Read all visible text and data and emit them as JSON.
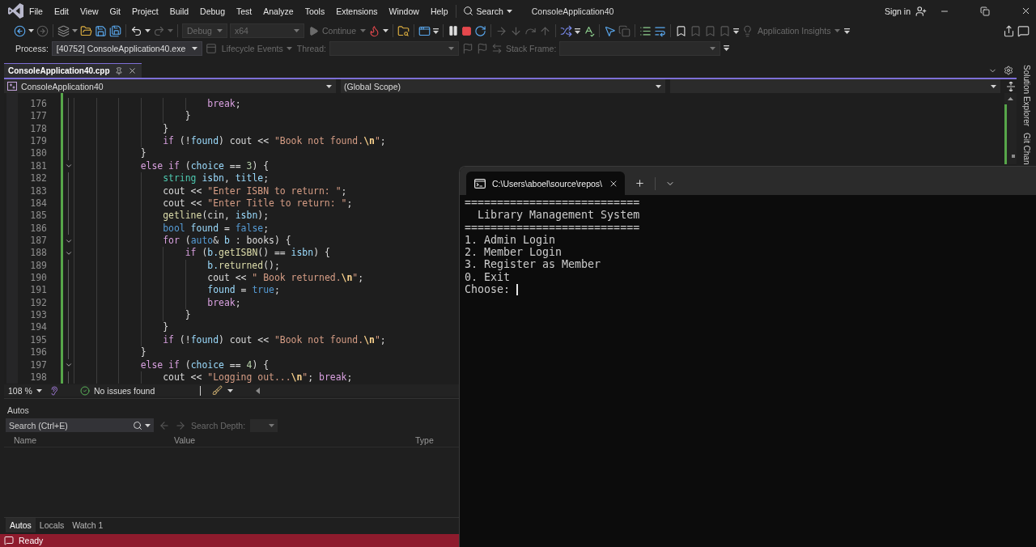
{
  "menu_bar": {
    "items": [
      "File",
      "Edit",
      "View",
      "Git",
      "Project",
      "Build",
      "Debug",
      "Test",
      "Analyze",
      "Tools",
      "Extensions",
      "Window",
      "Help"
    ],
    "search": "Search",
    "title": "ConsoleApplication40",
    "sign_in": "Sign in"
  },
  "toolbar": {
    "configuration": {
      "value": "Debug",
      "disabled": true
    },
    "platform": {
      "value": "x64",
      "disabled": true
    },
    "continue": {
      "label": "Continue",
      "disabled": true
    },
    "insights": {
      "label": "Application Insights",
      "disabled": true
    }
  },
  "debug_location": {
    "process": {
      "label": "Process:",
      "value": "[40752] ConsoleApplication40.exe"
    },
    "lifecycle": {
      "label": "Lifecycle Events",
      "disabled": true
    },
    "thread": {
      "label": "Thread:",
      "disabled": true
    },
    "stack_frame": {
      "label": "Stack Frame:",
      "disabled": true
    }
  },
  "document_tabs": [
    {
      "label": "ConsoleApplication40.cpp",
      "selected": true
    }
  ],
  "navigation": {
    "project": "ConsoleApplication40",
    "scope": "(Global Scope)"
  },
  "code": {
    "lines": [
      {
        "number": "176",
        "foldable": false,
        "tokens": [
          {
            "kind": "keyword",
            "text": "                        break"
          },
          {
            "kind": "plain",
            "text": ";"
          }
        ]
      },
      {
        "number": "177",
        "foldable": false,
        "tokens": [
          {
            "kind": "plain",
            "text": "                    }"
          }
        ]
      },
      {
        "number": "178",
        "foldable": false,
        "tokens": [
          {
            "kind": "plain",
            "text": "                }"
          }
        ]
      },
      {
        "number": "179",
        "foldable": false,
        "tokens": [
          {
            "kind": "keyword",
            "text": "                if"
          },
          {
            "kind": "plain",
            "text": " (!"
          },
          {
            "kind": "variable",
            "text": "found"
          },
          {
            "kind": "plain",
            "text": ") cout << "
          },
          {
            "kind": "string",
            "text": "\"Book not found."
          },
          {
            "kind": "escape",
            "text": "\\n"
          },
          {
            "kind": "string",
            "text": "\""
          },
          {
            "kind": "plain",
            "text": ";"
          }
        ]
      },
      {
        "number": "180",
        "foldable": false,
        "tokens": [
          {
            "kind": "plain",
            "text": "            }"
          }
        ]
      },
      {
        "number": "181",
        "foldable": true,
        "tokens": [
          {
            "kind": "keyword",
            "text": "            else if"
          },
          {
            "kind": "plain",
            "text": " ("
          },
          {
            "kind": "variable",
            "text": "choice"
          },
          {
            "kind": "plain",
            "text": " == "
          },
          {
            "kind": "number",
            "text": "3"
          },
          {
            "kind": "plain",
            "text": ") {"
          }
        ]
      },
      {
        "number": "182",
        "foldable": false,
        "tokens": [
          {
            "kind": "class",
            "text": "                string "
          },
          {
            "kind": "variable",
            "text": "isbn"
          },
          {
            "kind": "plain",
            "text": ", "
          },
          {
            "kind": "variable",
            "text": "title"
          },
          {
            "kind": "plain",
            "text": ";"
          }
        ]
      },
      {
        "number": "183",
        "foldable": false,
        "tokens": [
          {
            "kind": "plain",
            "text": "                cout << "
          },
          {
            "kind": "string",
            "text": "\"Enter ISBN to return: \""
          },
          {
            "kind": "plain",
            "text": ";"
          }
        ]
      },
      {
        "number": "184",
        "foldable": false,
        "tokens": [
          {
            "kind": "plain",
            "text": "                cout << "
          },
          {
            "kind": "string",
            "text": "\"Enter Title to return: \""
          },
          {
            "kind": "plain",
            "text": ";"
          }
        ]
      },
      {
        "number": "185",
        "foldable": false,
        "tokens": [
          {
            "kind": "function",
            "text": "                getline"
          },
          {
            "kind": "plain",
            "text": "(cin, "
          },
          {
            "kind": "variable",
            "text": "isbn"
          },
          {
            "kind": "plain",
            "text": ");"
          }
        ]
      },
      {
        "number": "186",
        "foldable": false,
        "tokens": [
          {
            "kind": "type",
            "text": "                bool "
          },
          {
            "kind": "variable",
            "text": "found"
          },
          {
            "kind": "plain",
            "text": " = "
          },
          {
            "kind": "type",
            "text": "false"
          },
          {
            "kind": "plain",
            "text": ";"
          }
        ]
      },
      {
        "number": "187",
        "foldable": true,
        "tokens": [
          {
            "kind": "keyword",
            "text": "                for"
          },
          {
            "kind": "plain",
            "text": " ("
          },
          {
            "kind": "type",
            "text": "auto"
          },
          {
            "kind": "plain",
            "text": "& "
          },
          {
            "kind": "variable",
            "text": "b"
          },
          {
            "kind": "plain",
            "text": " : books) {"
          }
        ]
      },
      {
        "number": "188",
        "foldable": true,
        "tokens": [
          {
            "kind": "keyword",
            "text": "                    if"
          },
          {
            "kind": "plain",
            "text": " ("
          },
          {
            "kind": "variable",
            "text": "b."
          },
          {
            "kind": "function",
            "text": "getISBN"
          },
          {
            "kind": "plain",
            "text": "() == "
          },
          {
            "kind": "variable",
            "text": "isbn"
          },
          {
            "kind": "plain",
            "text": ") {"
          }
        ]
      },
      {
        "number": "189",
        "foldable": false,
        "tokens": [
          {
            "kind": "variable",
            "text": "                        b."
          },
          {
            "kind": "function",
            "text": "returned"
          },
          {
            "kind": "plain",
            "text": "();"
          }
        ]
      },
      {
        "number": "190",
        "foldable": false,
        "tokens": [
          {
            "kind": "plain",
            "text": "                        cout << "
          },
          {
            "kind": "string",
            "text": "\" Book returned."
          },
          {
            "kind": "escape",
            "text": "\\n"
          },
          {
            "kind": "string",
            "text": "\""
          },
          {
            "kind": "plain",
            "text": ";"
          }
        ]
      },
      {
        "number": "191",
        "foldable": false,
        "tokens": [
          {
            "kind": "variable",
            "text": "                        found"
          },
          {
            "kind": "plain",
            "text": " = "
          },
          {
            "kind": "type",
            "text": "true"
          },
          {
            "kind": "plain",
            "text": ";"
          }
        ]
      },
      {
        "number": "192",
        "foldable": false,
        "tokens": [
          {
            "kind": "keyword",
            "text": "                        break"
          },
          {
            "kind": "plain",
            "text": ";"
          }
        ]
      },
      {
        "number": "193",
        "foldable": false,
        "tokens": [
          {
            "kind": "plain",
            "text": "                    }"
          }
        ]
      },
      {
        "number": "194",
        "foldable": false,
        "tokens": [
          {
            "kind": "plain",
            "text": "                }"
          }
        ]
      },
      {
        "number": "195",
        "foldable": false,
        "tokens": [
          {
            "kind": "keyword",
            "text": "                if"
          },
          {
            "kind": "plain",
            "text": " (!"
          },
          {
            "kind": "variable",
            "text": "found"
          },
          {
            "kind": "plain",
            "text": ") cout << "
          },
          {
            "kind": "string",
            "text": "\"Book not found."
          },
          {
            "kind": "escape",
            "text": "\\n"
          },
          {
            "kind": "string",
            "text": "\""
          },
          {
            "kind": "plain",
            "text": ";"
          }
        ]
      },
      {
        "number": "196",
        "foldable": false,
        "tokens": [
          {
            "kind": "plain",
            "text": "            }"
          }
        ]
      },
      {
        "number": "197",
        "foldable": true,
        "tokens": [
          {
            "kind": "keyword",
            "text": "            else if"
          },
          {
            "kind": "plain",
            "text": " ("
          },
          {
            "kind": "variable",
            "text": "choice"
          },
          {
            "kind": "plain",
            "text": " == "
          },
          {
            "kind": "number",
            "text": "4"
          },
          {
            "kind": "plain",
            "text": ") {"
          }
        ]
      },
      {
        "number": "198",
        "foldable": false,
        "tokens": [
          {
            "kind": "plain",
            "text": "                cout << "
          },
          {
            "kind": "string",
            "text": "\"Logging out..."
          },
          {
            "kind": "escape",
            "text": "\\n"
          },
          {
            "kind": "string",
            "text": "\""
          },
          {
            "kind": "plain",
            "text": "; "
          },
          {
            "kind": "keyword",
            "text": "break"
          },
          {
            "kind": "plain",
            "text": ";"
          }
        ]
      }
    ]
  },
  "editor_status": {
    "zoom": "108 %",
    "issues": "No issues found"
  },
  "autos": {
    "title": "Autos",
    "search": {
      "placeholder": "Search (Ctrl+E)"
    },
    "search_depth": {
      "label": "Search Depth:",
      "disabled": true
    },
    "columns": [
      "Name",
      "Value",
      "Type"
    ],
    "tabs": [
      {
        "label": "Autos",
        "selected": true
      },
      {
        "label": "Locals",
        "selected": false
      },
      {
        "label": "Watch 1",
        "selected": false
      }
    ]
  },
  "side_tabs": [
    "Solution Explorer",
    "Git Chan"
  ],
  "status_bar": {
    "text": "Ready"
  },
  "terminal": {
    "tab_title": "C:\\Users\\aboel\\source\\repos\\",
    "lines": [
      "===========================",
      "  Library Management System",
      "===========================",
      "1. Admin Login",
      "2. Member Login",
      "3. Register as Member",
      "0. Exit"
    ],
    "prompt": "Choose: "
  }
}
